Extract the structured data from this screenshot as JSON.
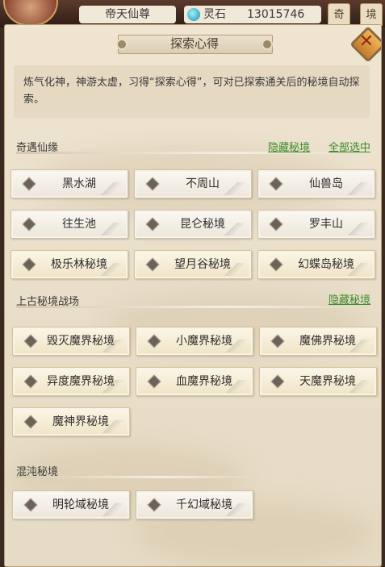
{
  "topbar": {
    "player_name": "帝天仙尊",
    "stone_label": "灵石",
    "stone_value": "13015746",
    "btn_a": "奇",
    "btn_b": "境"
  },
  "panel": {
    "title": "探索心得",
    "description": "炼气化神，神游太虚，习得“探索心得”，可对已探索通关后的秘境自动探索。"
  },
  "sections": [
    {
      "title": "奇遇仙缘",
      "hide_link": "隐藏秘境",
      "select_all_link": "全部选中",
      "items": [
        "黑水湖",
        "不周山",
        "仙兽岛",
        "往生池",
        "昆仑秘境",
        "罗丰山",
        "极乐林秘境",
        "望月谷秘境",
        "幻蝶岛秘境"
      ]
    },
    {
      "title": "上古秘境战场",
      "hide_link": "隐藏秘境",
      "items": [
        "毁灭魔界秘境",
        "小魔界秘境",
        "魔佛界秘境",
        "异度魔界秘境",
        "血魔界秘境",
        "天魔界秘境",
        "魔神界秘境"
      ]
    },
    {
      "title": "混沌秘境",
      "items": [
        "明轮域秘境",
        "千幻域秘境"
      ]
    }
  ]
}
